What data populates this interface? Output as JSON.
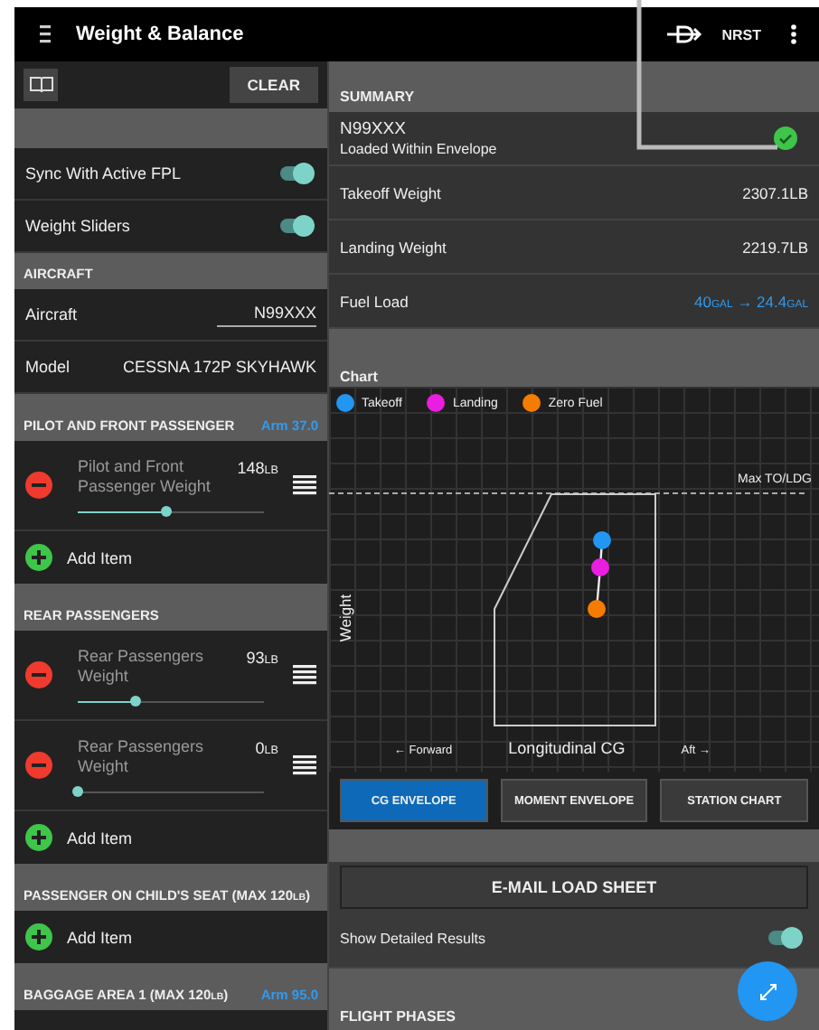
{
  "app_bar": {
    "title": "Weight & Balance",
    "nrst": "NRST"
  },
  "left": {
    "clear": "CLEAR",
    "toggles": [
      {
        "label": "Sync With Active FPL",
        "on": true
      },
      {
        "label": "Weight Sliders",
        "on": true
      }
    ],
    "aircraft": {
      "header": "AIRCRAFT",
      "aircraft_label": "Aircraft",
      "aircraft_value": "N99XXX",
      "model_label": "Model",
      "model_value": "CESSNA 172P SKYHAWK"
    },
    "sections": [
      {
        "header": "PILOT AND FRONT PASSENGER",
        "arm": "Arm 37.0",
        "items": [
          {
            "label": "Pilot and Front Passenger Weight",
            "value": "148",
            "unit": "LB",
            "level": 0.48
          }
        ],
        "add": "Add Item"
      },
      {
        "header": "REAR PASSENGERS",
        "items": [
          {
            "label": "Rear Passengers Weight",
            "value": "93",
            "unit": "LB",
            "level": 0.31
          },
          {
            "label": "Rear Passengers Weight",
            "value": "0",
            "unit": "LB",
            "level": 0
          }
        ],
        "add": "Add Item"
      },
      {
        "header": "PASSENGER ON CHILD'S SEAT (MAX 120",
        "header_unit": "LB",
        "header_suffix": ")",
        "add": "Add Item"
      },
      {
        "header": "BAGGAGE AREA 1 (MAX 120",
        "header_unit": "LB",
        "header_suffix": ")",
        "arm": "Arm 95.0"
      }
    ]
  },
  "right": {
    "summary_header": "SUMMARY",
    "tail": "N99XXX",
    "status": "Loaded Within Envelope",
    "within_envelope": true,
    "rows": [
      {
        "label": "Takeoff Weight",
        "value": "2307.1LB"
      },
      {
        "label": "Landing Weight",
        "value": "2219.7LB"
      }
    ],
    "fuel": {
      "label": "Fuel Load",
      "from": "40",
      "from_unit": "GAL",
      "arrow": "→",
      "to": "24.4",
      "to_unit": "GAL"
    },
    "chart_header": "Chart",
    "legend": [
      {
        "label": "Takeoff",
        "color": "#2196f3"
      },
      {
        "label": "Landing",
        "color": "#e91ee0"
      },
      {
        "label": "Zero Fuel",
        "color": "#f57c00"
      }
    ],
    "chart_labels": {
      "max": "Max TO/LDG",
      "y": "Weight",
      "forward": "← Forward",
      "x": "Longitudinal CG",
      "aft": "Aft →"
    },
    "chart_tabs": [
      {
        "label": "CG ENVELOPE",
        "selected": true
      },
      {
        "label": "MOMENT ENVELOPE",
        "selected": false
      },
      {
        "label": "STATION CHART",
        "selected": false
      }
    ],
    "email": "E-MAIL LOAD SHEET",
    "detailed": {
      "label": "Show Detailed Results",
      "on": true
    },
    "flight_phases": "FLIGHT PHASES"
  }
}
